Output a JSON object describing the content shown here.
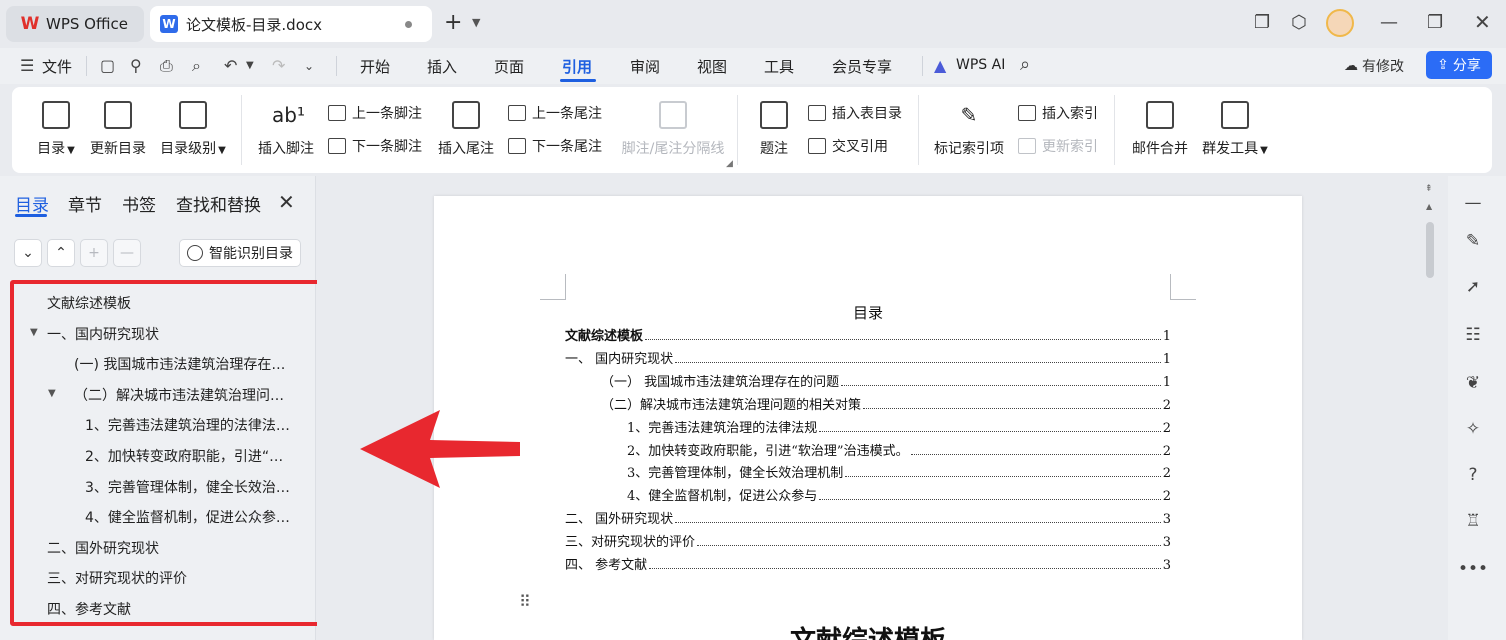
{
  "titlebar": {
    "app_tab": "WPS Office",
    "doc_tab": "论文模板-目录.docx"
  },
  "menubar": {
    "file": "文件",
    "tabs": [
      "开始",
      "插入",
      "页面",
      "引用",
      "审阅",
      "视图",
      "工具",
      "会员专享"
    ],
    "active_tab": "引用",
    "wps_ai": "WPS AI",
    "modify": "有修改",
    "share": "分享"
  },
  "ribbon": {
    "toc": "目录",
    "update_toc": "更新目录",
    "toc_level": "目录级别",
    "insert_footnote": "插入脚注",
    "prev_footnote": "上一条脚注",
    "next_footnote": "下一条脚注",
    "insert_endnote": "插入尾注",
    "prev_endnote": "上一条尾注",
    "next_endnote": "下一条尾注",
    "footnote_separator": "脚注/尾注分隔线",
    "caption": "题注",
    "insert_table_of_figures": "插入表目录",
    "cross_reference": "交叉引用",
    "mark_index": "标记索引项",
    "insert_index": "插入索引",
    "update_index": "更新索引",
    "mail_merge": "邮件合并",
    "mass_send": "群发工具"
  },
  "leftpanel": {
    "tabs": [
      "目录",
      "章节",
      "书签",
      "查找和替换"
    ],
    "active_tab": "目录",
    "smart_toc": "智能识别目录",
    "outline": [
      "文献综述模板",
      "一、国内研究现状",
      "(一) 我国城市违法建筑治理存在…",
      "（二）解决城市违法建筑治理问…",
      "1、完善违法建筑治理的法律法…",
      "2、加快转变政府职能，引进“…",
      "3、完善管理体制，健全长效治…",
      "4、健全监督机制，促进公众参…",
      "二、国外研究现状",
      "三、对研究现状的评价",
      "四、参考文献"
    ]
  },
  "document": {
    "toc_heading": "目录",
    "toc_entries": [
      {
        "text": "文献综述模板",
        "page": "1"
      },
      {
        "text": "一、  国内研究现状",
        "page": "1"
      },
      {
        "text": "（一）  我国城市违法建筑治理存在的问题",
        "page": "1"
      },
      {
        "text": "（二）解决城市违法建筑治理问题的相关对策",
        "page": "2"
      },
      {
        "text": "1、完善违法建筑治理的法律法规",
        "page": "2"
      },
      {
        "text": "2、加快转变政府职能，引进“软治理”治违模式。",
        "page": "2"
      },
      {
        "text": "3、完善管理体制，健全长效治理机制",
        "page": "2"
      },
      {
        "text": "4、健全监督机制，促进公众参与",
        "page": "2"
      },
      {
        "text": "二、  国外研究现状",
        "page": "3"
      },
      {
        "text": "三、对研究现状的评价",
        "page": "3"
      },
      {
        "text": "四、  参考文献",
        "page": "3"
      }
    ],
    "body_heading": "文献综述模板"
  },
  "colors": {
    "accent": "#1e5fe0",
    "share_button": "#2b6cf6",
    "highlight_red": "#e8282f"
  }
}
